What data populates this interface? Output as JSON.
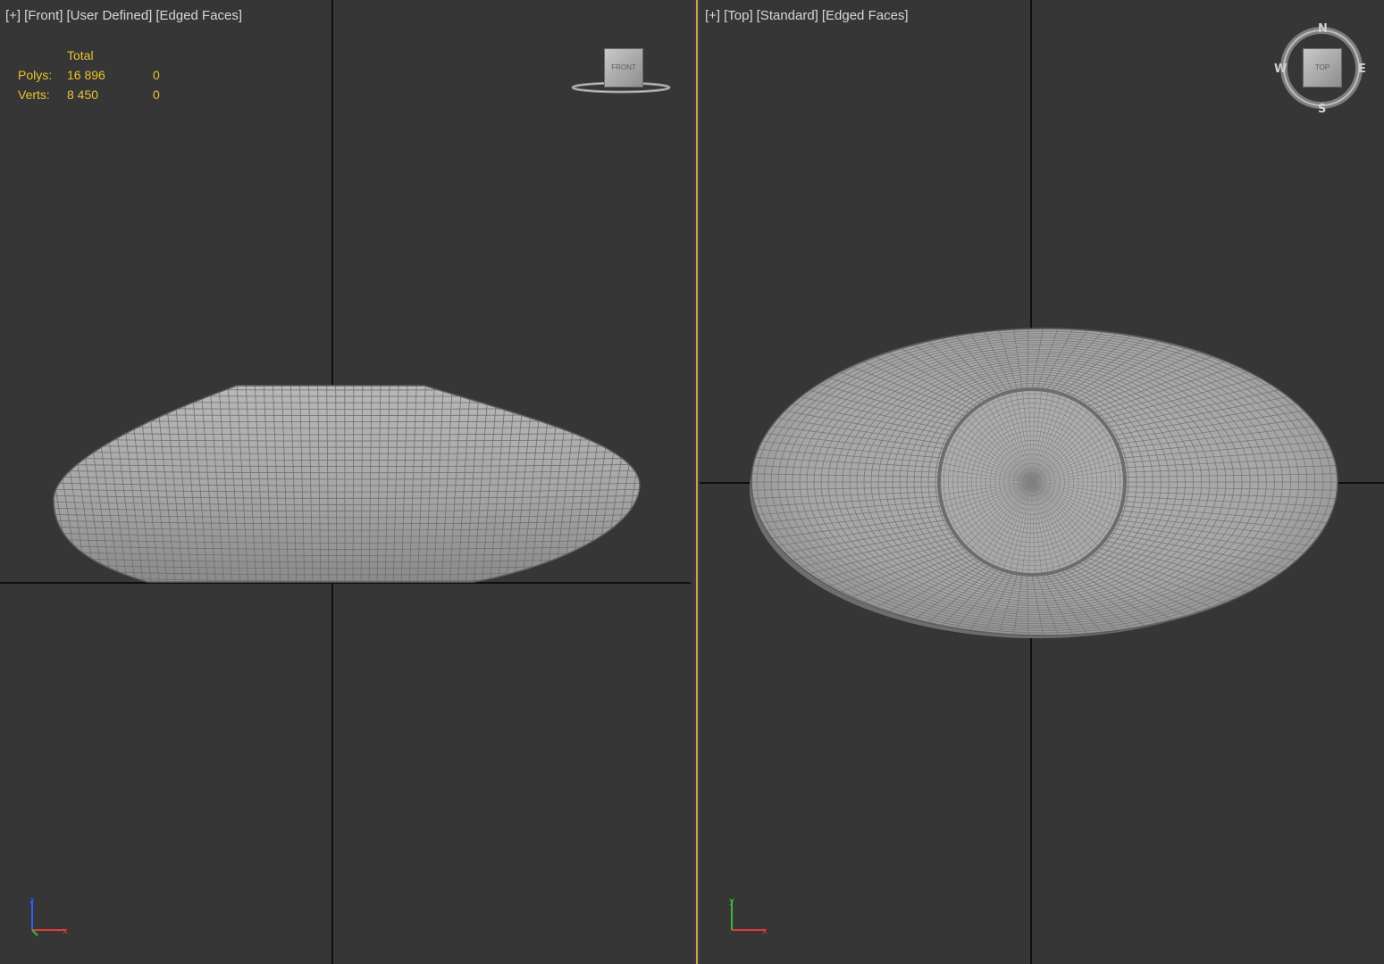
{
  "left_viewport": {
    "label_parts": [
      "[+]",
      "[Front]",
      "[User Defined]",
      "[Edged Faces]"
    ],
    "stats": {
      "header": "Total",
      "rows": [
        {
          "label": "Polys:",
          "total": "16 896",
          "selected": "0"
        },
        {
          "label": "Verts:",
          "total": "8 450",
          "selected": "0"
        }
      ]
    },
    "viewcube_label": "FRONT",
    "axis_labels": {
      "up": "z",
      "right": "x"
    }
  },
  "right_viewport": {
    "label_parts": [
      "[+]",
      "[Top]",
      "[Standard]",
      "[Edged Faces]"
    ],
    "viewcube_label": "TOP",
    "compass": {
      "n": "N",
      "s": "S",
      "e": "E",
      "w": "W"
    },
    "axis_labels": {
      "up": "y",
      "right": "x"
    }
  },
  "colors": {
    "viewport_bg": "#363636",
    "active_border": "#c8a24a",
    "stats_text": "#e8c330",
    "mesh_fill": "#a9a9a9",
    "mesh_wire": "#6f6f6f"
  }
}
